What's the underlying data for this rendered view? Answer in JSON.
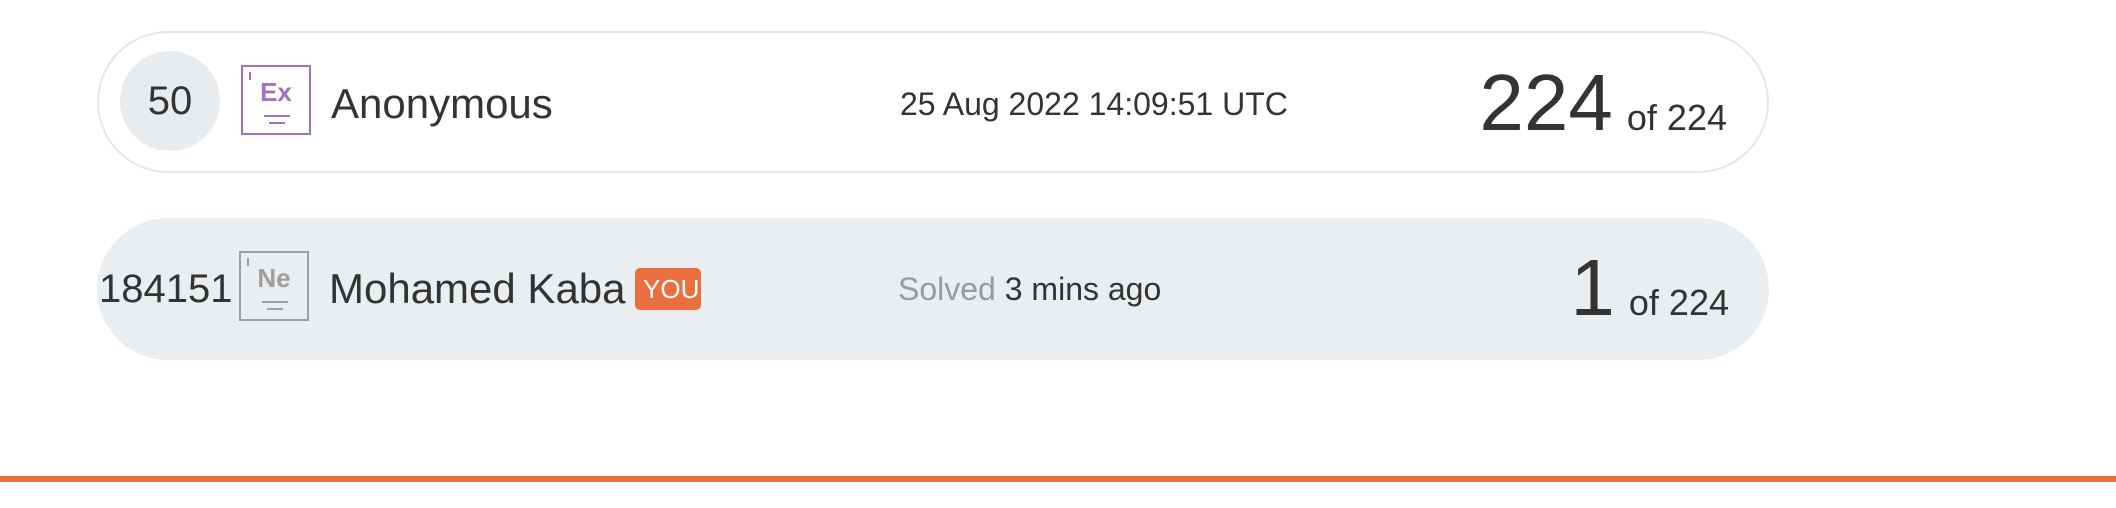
{
  "leaderboard": {
    "rows": [
      {
        "rank": "50",
        "badge": {
          "symbol": "Ex",
          "color": "#a76fc0",
          "icon": "element-badge-icon"
        },
        "name": "Anonymous",
        "meta_muted": "",
        "meta": "25 Aug 2022 14:09:51 UTC",
        "score": "224",
        "score_suffix": "of 224"
      },
      {
        "rank": "184151",
        "badge": {
          "symbol": "Ne",
          "color": "#9e9e9e",
          "icon": "element-badge-icon"
        },
        "name": "Mohamed Kaba",
        "you_tag": "YOU",
        "meta_muted": "Solved",
        "meta": "3 mins ago",
        "score": "1",
        "score_suffix": "of 224"
      }
    ]
  },
  "colors": {
    "accent": "#ea6f40",
    "highlight_row_bg": "#eaeef1"
  }
}
